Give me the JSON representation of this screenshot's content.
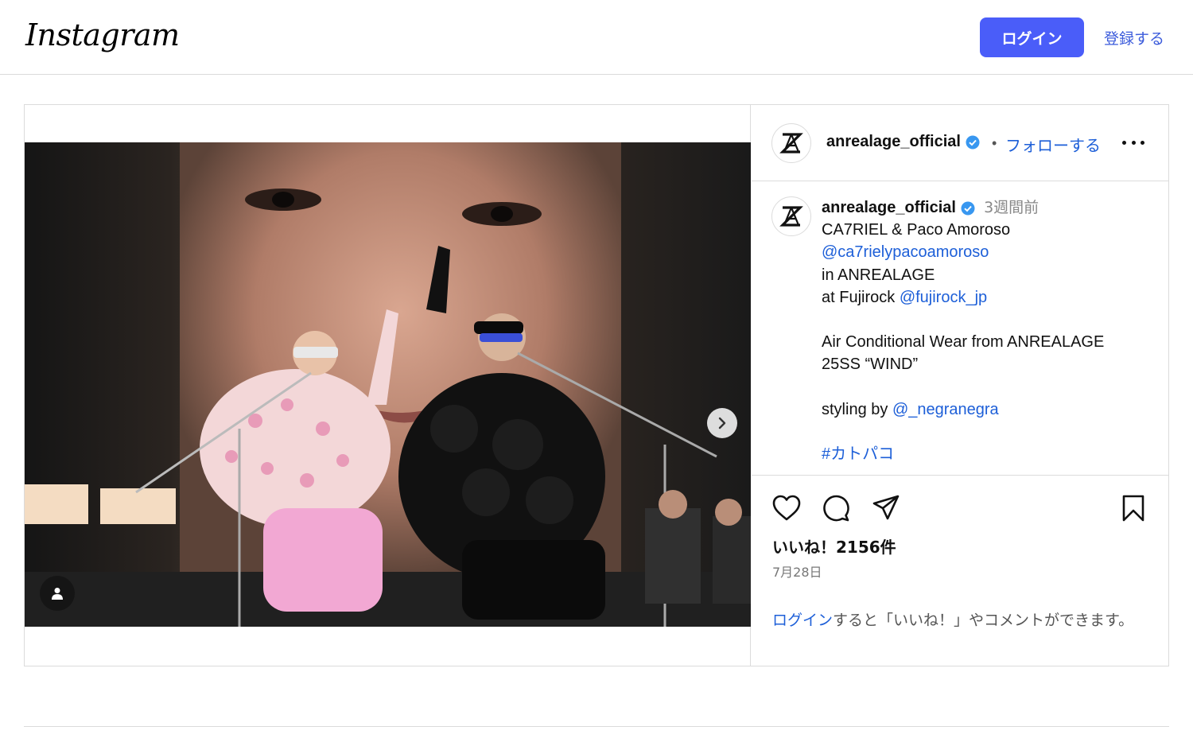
{
  "header": {
    "logo_text": "Instagram",
    "login_label": "ログイン",
    "signup_label": "登録する"
  },
  "post": {
    "username": "anrealage_official",
    "follow_label": "フォローする",
    "separator": "•",
    "caption": {
      "username": "anrealage_official",
      "time_ago": "3週間前",
      "line1": "CA7RIEL & Paco Amoroso",
      "mention1": "@ca7rielypacoamoroso",
      "line3": "in ANREALAGE",
      "line4_prefix": "at Fujirock ",
      "mention2": "@fujirock_jp",
      "line6": "Air Conditional Wear from ANREALAGE",
      "line7": "25SS “WIND”",
      "line9_prefix": "styling by ",
      "mention3": "@_negranegra",
      "hashtag": "#カトパコ"
    },
    "likes_text": "いいね！2156件",
    "date_text": "7月28日",
    "login_link": "ログイン",
    "login_prompt": "すると「いいね！」やコメントができます。"
  },
  "icons": [
    "anrealage-logo-icon",
    "verified-icon",
    "more-icon",
    "heart-icon",
    "comment-icon",
    "share-icon",
    "bookmark-icon",
    "chevron-right-icon",
    "user-tag-icon"
  ],
  "colors": {
    "accent": "#4a5df9",
    "link": "#1d5fd8",
    "border": "#dbdbdb"
  }
}
